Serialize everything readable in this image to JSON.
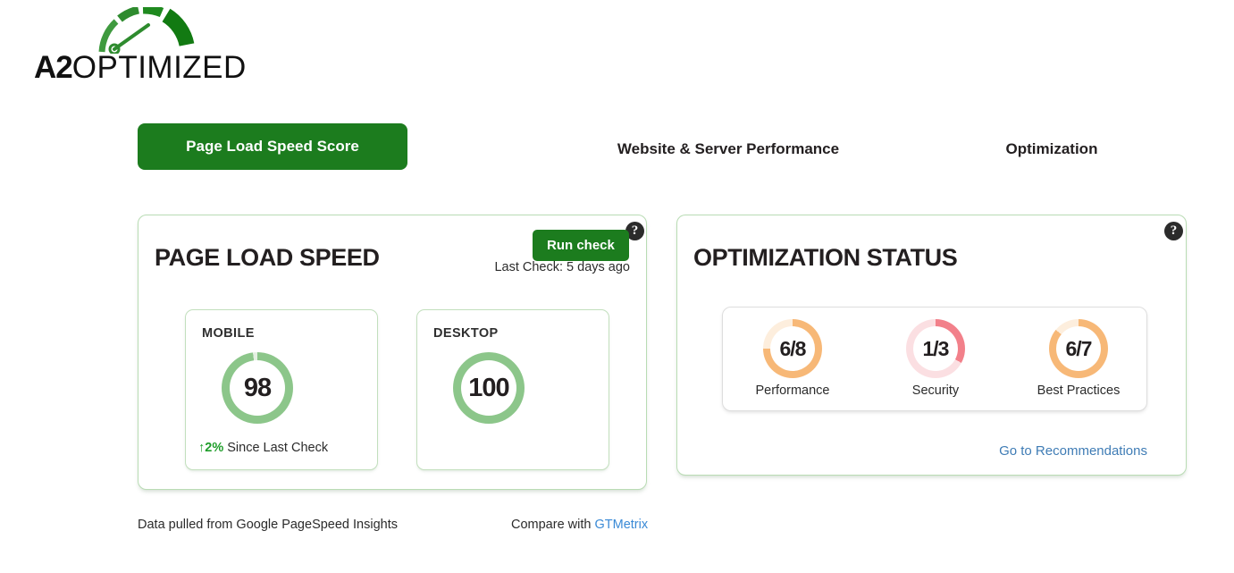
{
  "brand": {
    "name_bold": "A2",
    "name_light": "OPTIMIZED",
    "logo_icon": "speedometer-gauge-icon",
    "green": "#1c7c1e"
  },
  "tabs": [
    {
      "label": "Page Load Speed Score",
      "active": true
    },
    {
      "label": "Website & Server Performance",
      "active": false
    },
    {
      "label": "Optimization",
      "active": false
    }
  ],
  "speed_card": {
    "title": "PAGE LOAD SPEED",
    "run_check_label": "Run check",
    "last_check": "Last Check: 5 days ago",
    "help_icon": "question-mark-icon",
    "scores": [
      {
        "label": "MOBILE",
        "value": "98",
        "percent": 98,
        "color": "#8cc68a",
        "track": "#e4f0e2",
        "delta_arrow": "↑",
        "delta_value": "2%",
        "delta_text": "Since Last Check"
      },
      {
        "label": "DESKTOP",
        "value": "100",
        "percent": 100,
        "color": "#8cc68a",
        "track": "#e4f0e2",
        "delta_arrow": "",
        "delta_value": "",
        "delta_text": ""
      }
    ]
  },
  "status_card": {
    "title": "OPTIMIZATION STATUS",
    "help_icon": "question-mark-icon",
    "items": [
      {
        "label": "Performance",
        "value": "6/8",
        "percent": 75,
        "color": "#f7b877",
        "track": "#fdeedd"
      },
      {
        "label": "Security",
        "value": "1/3",
        "percent": 33,
        "color": "#f2808a",
        "track": "#fbdfe2"
      },
      {
        "label": "Best Practices",
        "value": "6/7",
        "percent": 86,
        "color": "#f7b877",
        "track": "#fdeedd"
      }
    ],
    "recommend_link": "Go to Recommendations"
  },
  "footer": {
    "data_source": "Data pulled from Google PageSpeed Insights",
    "compare_prefix": "Compare with ",
    "compare_link": "GTMetrix"
  },
  "chart_data": {
    "type": "bar",
    "title": "A2 Optimized dashboard gauges",
    "series": [
      {
        "name": "Page Load Speed",
        "categories": [
          "Mobile",
          "Desktop"
        ],
        "values": [
          98,
          100
        ],
        "ylim": [
          0,
          100
        ]
      },
      {
        "name": "Optimization Status",
        "categories": [
          "Performance",
          "Security",
          "Best Practices"
        ],
        "values": [
          75,
          33,
          86
        ],
        "labels": [
          "6/8",
          "1/3",
          "6/7"
        ],
        "ylim": [
          0,
          100
        ]
      }
    ]
  }
}
